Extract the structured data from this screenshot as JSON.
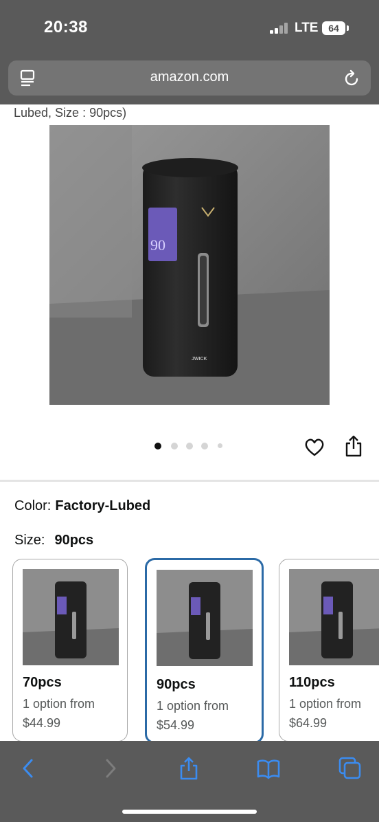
{
  "status_bar": {
    "time": "20:38",
    "carrier": "LTE",
    "battery": "64"
  },
  "browser": {
    "url": "amazon.com"
  },
  "product": {
    "title_fragment": "Lubed, Size : 90pcs)",
    "image_label": "JWICK",
    "image_qty": "90",
    "carousel": {
      "count": 5,
      "active_index": 0
    }
  },
  "variations": {
    "color_label": "Color:",
    "color_value": "Factory-Lubed",
    "size_label": "Size:",
    "size_value": "90pcs",
    "options": [
      {
        "name": "70pcs",
        "options_text": "1 option from",
        "price": "$44.99",
        "selected": false
      },
      {
        "name": "90pcs",
        "options_text": "1 option from",
        "price": "$54.99",
        "selected": true
      },
      {
        "name": "110pcs",
        "options_text": "1 option from",
        "price": "$64.99",
        "selected": false
      }
    ]
  },
  "toolbar": {
    "items": [
      "back-icon",
      "forward-icon",
      "share-icon",
      "bookmarks-icon",
      "tabs-icon"
    ]
  },
  "colors": {
    "accent": "#2b6aa6",
    "toolbar_icon": "#3b8cf0",
    "chrome_bg": "#5a5a5a"
  }
}
